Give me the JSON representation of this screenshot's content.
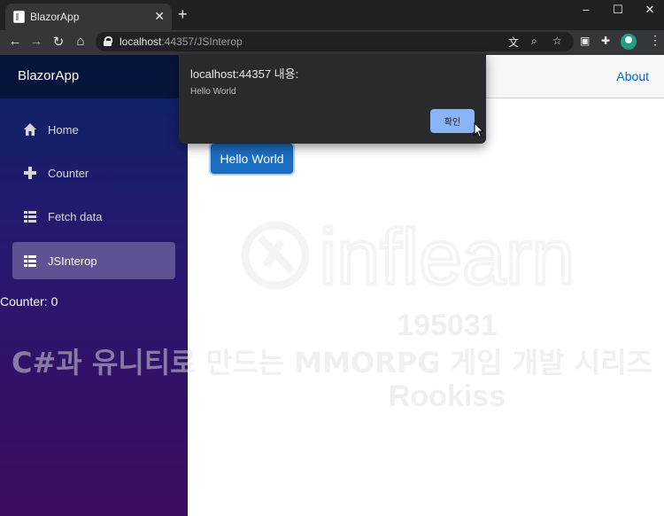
{
  "browser": {
    "tab_title": "BlazorApp",
    "tab_close": "✕",
    "new_tab": "+",
    "window_controls": {
      "minimize": "–",
      "maximize": "☐",
      "close": "✕"
    },
    "nav": {
      "back": "←",
      "forward": "→",
      "reload": "↻",
      "home": "⌂"
    },
    "url_host": "localhost",
    "url_rest": ":44357/JSInterop",
    "menu": "⋮"
  },
  "sidebar": {
    "brand": "BlazorApp",
    "items": [
      {
        "label": "Home",
        "icon": "home-icon"
      },
      {
        "label": "Counter",
        "icon": "plus-icon"
      },
      {
        "label": "Fetch data",
        "icon": "list-icon"
      },
      {
        "label": "JSInterop",
        "icon": "list-icon",
        "active": true
      }
    ],
    "counter_text": "Counter: 0"
  },
  "topbar": {
    "about": "About"
  },
  "main": {
    "hello_button": "Hello World"
  },
  "alert": {
    "title": "localhost:44357 내용:",
    "message": "Hello World",
    "ok_button": "확인"
  },
  "watermark": {
    "logo_text": "inflearn",
    "id": "195031",
    "course": "C#과 유니티로 만드는 MMORPG 게임 개발 시리즈",
    "author": "Rookiss"
  },
  "colors": {
    "accent": "#1b6ec2",
    "link": "#0366d6",
    "dialog_bg": "#292a2d",
    "dialog_button": "#8ab4f8"
  }
}
